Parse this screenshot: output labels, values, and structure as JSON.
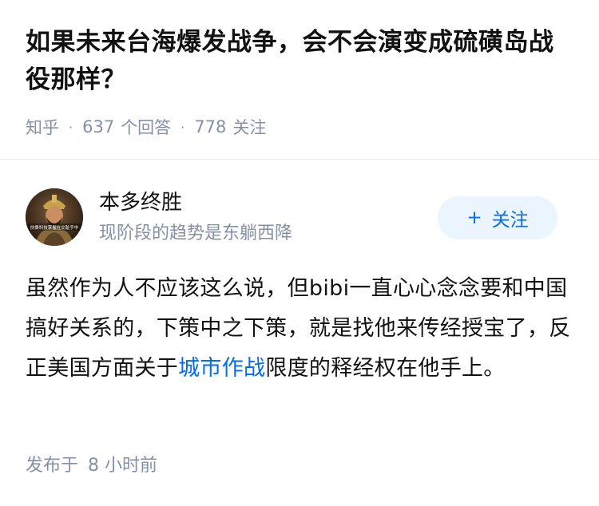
{
  "question": {
    "title": "如果未来台海爆发战争，会不会演变成硫磺岛战役那样？",
    "source": "知乎",
    "separator": "·",
    "answers_count": "637",
    "answers_label": "个回答",
    "followers_count": "778",
    "followers_label": "关注"
  },
  "author": {
    "name": "本多终胜",
    "headline": "现阶段的趋势是东躺西降",
    "avatar_icon": "avatar-portrait",
    "avatar_caption": "扶桑科技掌握在交趾手中",
    "follow_label": "关注",
    "follow_icon": "+"
  },
  "answer": {
    "text_before": "虽然作为人不应该这么说，但bibi一直心心念念要和中国搞好关系的，下策中之下策，就是找他来传经授宝了，反正美国方面关于",
    "link_text": "城市作战",
    "text_after": "限度的释经权在他手上。",
    "publish_label": "发布于",
    "publish_time": "8 小时前"
  },
  "colors": {
    "text": "#121212",
    "meta": "#8590a6",
    "accent": "#056de8",
    "button_bg": "#ebf5ff"
  }
}
